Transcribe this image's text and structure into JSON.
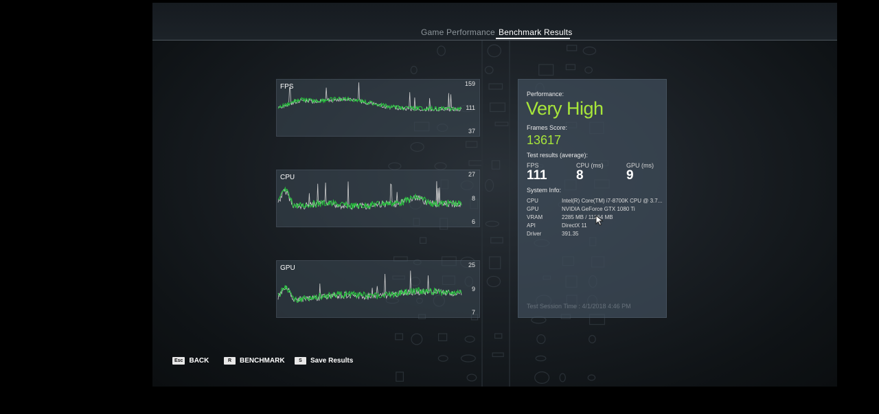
{
  "tabs": {
    "game_performance": "Game Performance",
    "benchmark_results": "Benchmark Results"
  },
  "graphs": [
    {
      "title": "FPS",
      "ticks": {
        "top": "159",
        "mid": "111",
        "bottom": "37"
      },
      "line_color": "#27c23d"
    },
    {
      "title": "CPU",
      "ticks": {
        "top": "27",
        "mid": "8",
        "bottom": "6"
      },
      "line_color": "#27c23d"
    },
    {
      "title": "GPU",
      "ticks": {
        "top": "25",
        "mid": "9",
        "bottom": "7"
      },
      "line_color": "#27c23d"
    }
  ],
  "results": {
    "performance_label": "Performance:",
    "performance_value": "Very High",
    "frames_score_label": "Frames Score:",
    "frames_score_value": "13617",
    "test_results_label": "Test results (average):",
    "stats": [
      {
        "label": "FPS",
        "value": "111"
      },
      {
        "label": "CPU (ms)",
        "value": "8"
      },
      {
        "label": "GPU (ms)",
        "value": "9"
      }
    ],
    "system_info_label": "System Info:",
    "system_info": [
      {
        "key": "CPU",
        "value": "Intel(R) Core(TM) i7-8700K CPU @ 3.7..."
      },
      {
        "key": "GPU",
        "value": "NVIDIA GeForce GTX 1080 Ti"
      },
      {
        "key": "VRAM",
        "value": "2285 MB / 11264 MB"
      },
      {
        "key": "API",
        "value": "DirectX 11"
      },
      {
        "key": "Driver",
        "value": "391.35"
      }
    ],
    "session_time": "Test Session Time : 4/1/2018 4:46 PM"
  },
  "footer": [
    {
      "key": "Esc",
      "label": "BACK"
    },
    {
      "key": "R",
      "label": "BENCHMARK"
    },
    {
      "key": "S",
      "label": "Save Results"
    }
  ],
  "colors": {
    "accent_green": "#a8e63a",
    "graph_green": "#27c23d",
    "graph_white": "#d0d0d0"
  }
}
